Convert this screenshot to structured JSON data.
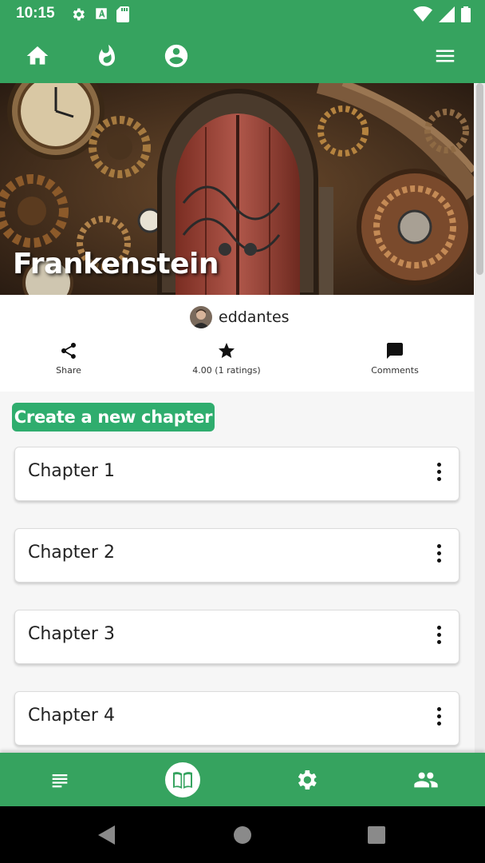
{
  "status_bar": {
    "time": "10:15"
  },
  "book": {
    "title": "Frankenstein",
    "author": "eddantes"
  },
  "actions": {
    "share": "Share",
    "rating": "4.00 (1 ratings)",
    "comments": "Comments"
  },
  "create_chapter_label": "Create a new chapter",
  "chapters": [
    {
      "title": "Chapter 1"
    },
    {
      "title": "Chapter 2"
    },
    {
      "title": "Chapter 3"
    },
    {
      "title": "Chapter 4"
    }
  ],
  "icons": {
    "top_nav": [
      "home-icon",
      "fire-icon",
      "account-circle-icon",
      "menu-icon"
    ],
    "bottom_nav": [
      "list-icon",
      "book-icon",
      "gear-icon",
      "people-icon"
    ],
    "system_nav": [
      "back-icon",
      "home-circle-icon",
      "recents-icon"
    ]
  },
  "colors": {
    "primary": "#36a35f",
    "accent": "#2fad6e"
  }
}
